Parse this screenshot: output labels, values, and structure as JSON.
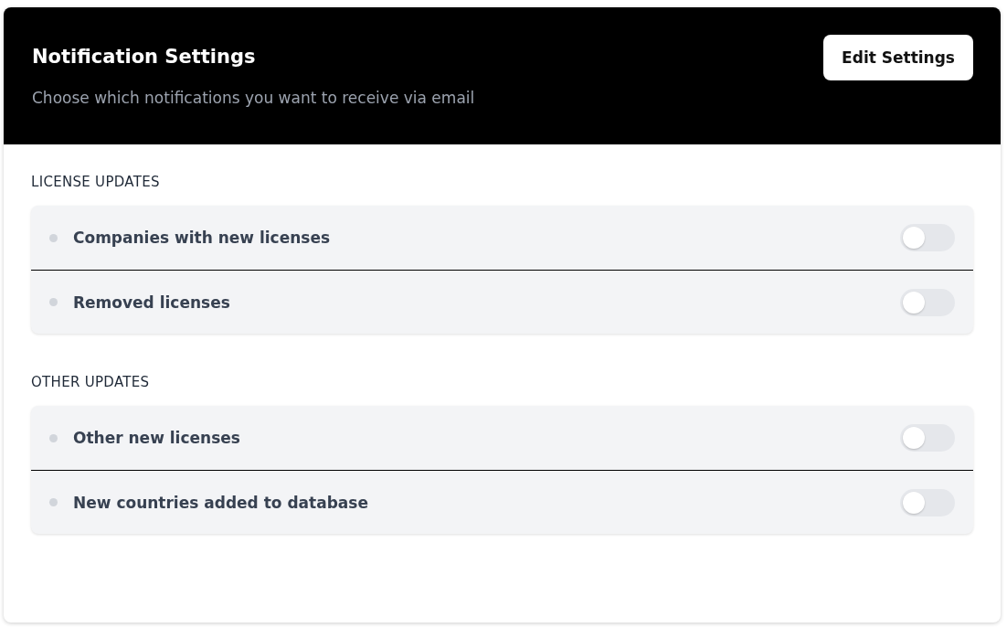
{
  "header": {
    "title": "Notification Settings",
    "subtitle": "Choose which notifications you want to receive via email",
    "button": "Edit Settings"
  },
  "sections": [
    {
      "heading": "LICENSE UPDATES",
      "items": [
        {
          "label": "Companies with new licenses",
          "on": false
        },
        {
          "label": "Removed licenses",
          "on": false
        }
      ]
    },
    {
      "heading": "OTHER UPDATES",
      "items": [
        {
          "label": "Other new licenses",
          "on": false
        },
        {
          "label": "New countries added to database",
          "on": false
        }
      ]
    }
  ]
}
